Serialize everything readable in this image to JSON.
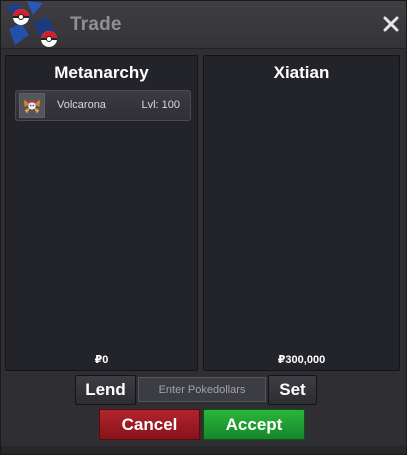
{
  "window": {
    "title": "Trade",
    "close_glyph": "✕"
  },
  "left_panel": {
    "player_name": "Metanarchy",
    "items": [
      {
        "icon": "volcarona-sprite-icon",
        "name": "Volcarona",
        "level": "Lvl: 100"
      }
    ],
    "money": "₽0"
  },
  "right_panel": {
    "player_name": "Xiatian",
    "money": "₽300,000"
  },
  "controls": {
    "lend_label": "Lend",
    "money_placeholder": "Enter Pokedollars",
    "set_label": "Set",
    "cancel_label": "Cancel",
    "accept_label": "Accept"
  },
  "colors": {
    "cancel": "#a01a22",
    "accept": "#22a034",
    "panel_bg": "#23232a"
  }
}
